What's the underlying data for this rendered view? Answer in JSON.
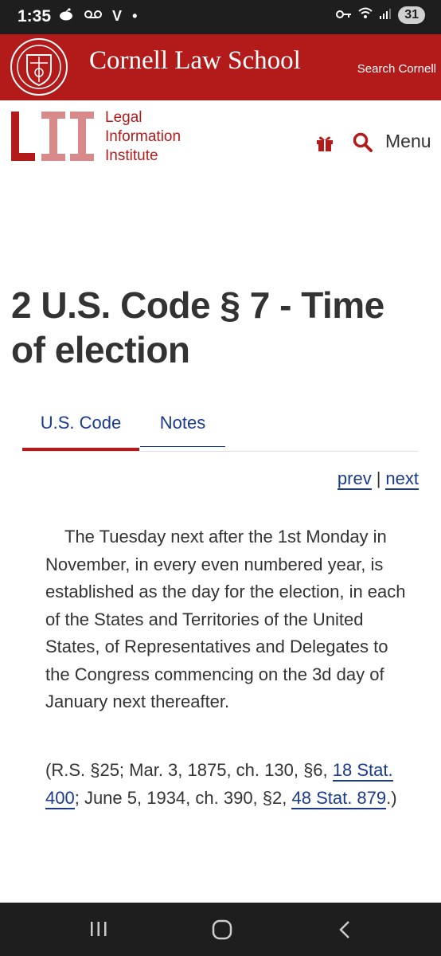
{
  "status_bar": {
    "time": "1:35",
    "left_icons": [
      "reddit-icon",
      "voicemail-icon",
      "v-icon",
      "dot-icon"
    ],
    "left_glyph_v": "V",
    "left_glyph_dot": "•",
    "right_icons": [
      "key-icon",
      "wifi-icon",
      "signal-icon"
    ],
    "battery": "31"
  },
  "cornell_header": {
    "title": "Cornell Law School",
    "search_label": "Search Cornell",
    "bg_color": "#b31b1b"
  },
  "lii_header": {
    "logo_text": "LII",
    "name_lines": [
      "Legal",
      "Information",
      "Institute"
    ],
    "menu_label": "Menu"
  },
  "page": {
    "title": "2 U.S. Code § 7 - Time of election",
    "tabs": [
      {
        "label": "U.S. Code",
        "active": true
      },
      {
        "label": "Notes",
        "active": false
      }
    ],
    "prev_label": "prev",
    "separator": "|",
    "next_label": "next",
    "body_text": "The Tuesday next after the 1st Monday in November, in every even numbered year, is established as the day for the election, in each of the States and Territories of the United States, of Representatives and Delegates to the Congress commencing on the 3d day of January next thereafter.",
    "citation": {
      "part1": "(R.S. §25; Mar. 3, 1875, ch. 130, §6, ",
      "link1": "18 Stat. 400",
      "part2": "; June 5, 1934, ch. 390, §2, ",
      "link2": "48 Stat. 879",
      "part3": ".)"
    }
  },
  "colors": {
    "accent_red": "#b31b1b",
    "link_blue": "#1a3a8c",
    "text": "#333333"
  }
}
